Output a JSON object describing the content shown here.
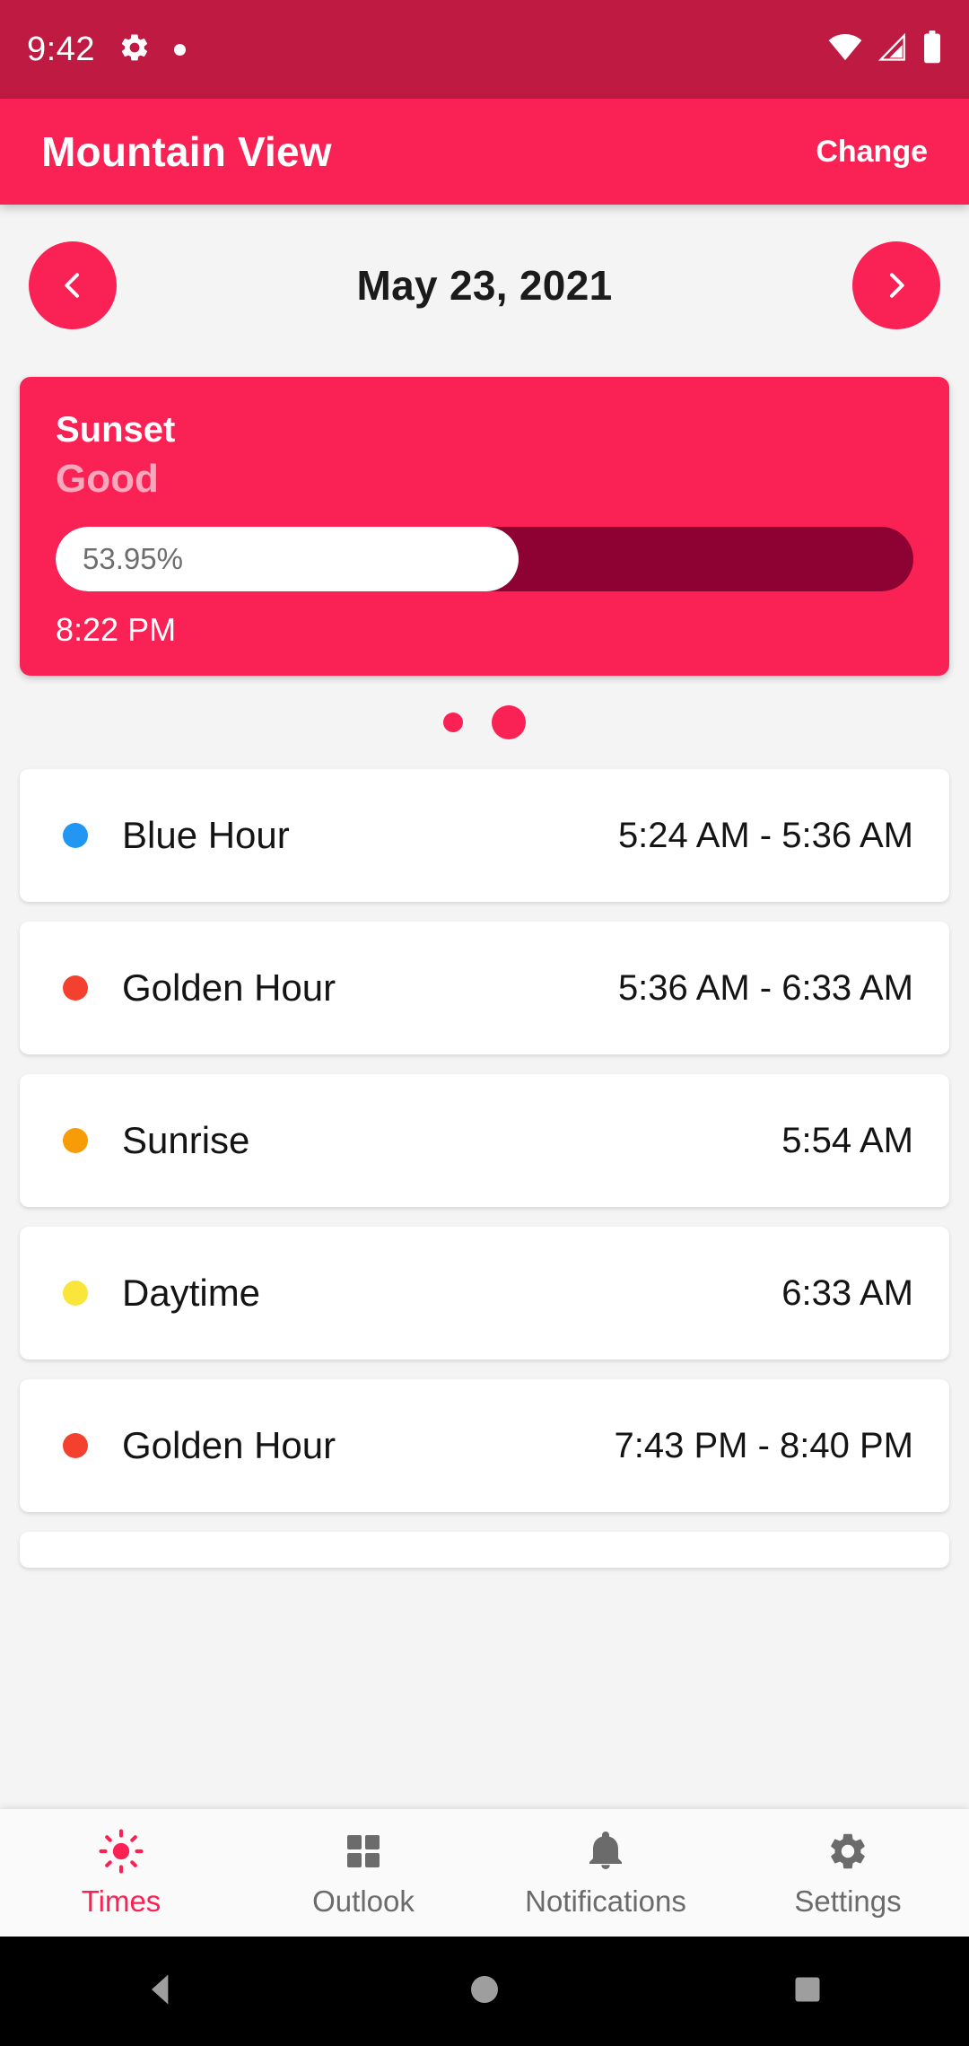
{
  "status_bar": {
    "time": "9:42",
    "icons": [
      "gear-icon",
      "dot-indicator",
      "wifi-icon",
      "signal-icon",
      "battery-icon"
    ],
    "background": "#BE1A42"
  },
  "app_bar": {
    "title": "Mountain View",
    "action_label": "Change",
    "background": "#FA2254"
  },
  "date_nav": {
    "prev_label": "‹",
    "date": "May 23, 2021",
    "next_label": "›"
  },
  "hero_card": {
    "title": "Sunset",
    "quality": "Good",
    "progress_percent": 53.95,
    "progress_label": "53.95%",
    "time": "8:22 PM",
    "background": "#FA2254",
    "track_color": "#8E0233"
  },
  "page_indicator": {
    "count": 2,
    "active_index": 1,
    "color": "#FA2254"
  },
  "events": [
    {
      "name": "Blue Hour",
      "time": "5:24 AM - 5:36 AM",
      "color": "#2196F3"
    },
    {
      "name": "Golden Hour",
      "time": "5:36 AM - 6:33 AM",
      "color": "#F4402F"
    },
    {
      "name": "Sunrise",
      "time": "5:54 AM",
      "color": "#F79B07"
    },
    {
      "name": "Daytime",
      "time": "6:33 AM",
      "color": "#FAE53B"
    },
    {
      "name": "Golden Hour",
      "time": "7:43 PM - 8:40 PM",
      "color": "#F4402F"
    }
  ],
  "bottom_nav": {
    "active_index": 0,
    "active_color": "#FA2254",
    "inactive_color": "#6b6b6b",
    "items": [
      {
        "label": "Times",
        "icon": "sun-icon"
      },
      {
        "label": "Outlook",
        "icon": "grid-icon"
      },
      {
        "label": "Notifications",
        "icon": "bell-icon"
      },
      {
        "label": "Settings",
        "icon": "gear-icon"
      }
    ]
  },
  "system_nav": {
    "buttons": [
      {
        "icon": "back-triangle-icon"
      },
      {
        "icon": "home-circle-icon"
      },
      {
        "icon": "recents-square-icon"
      }
    ]
  }
}
